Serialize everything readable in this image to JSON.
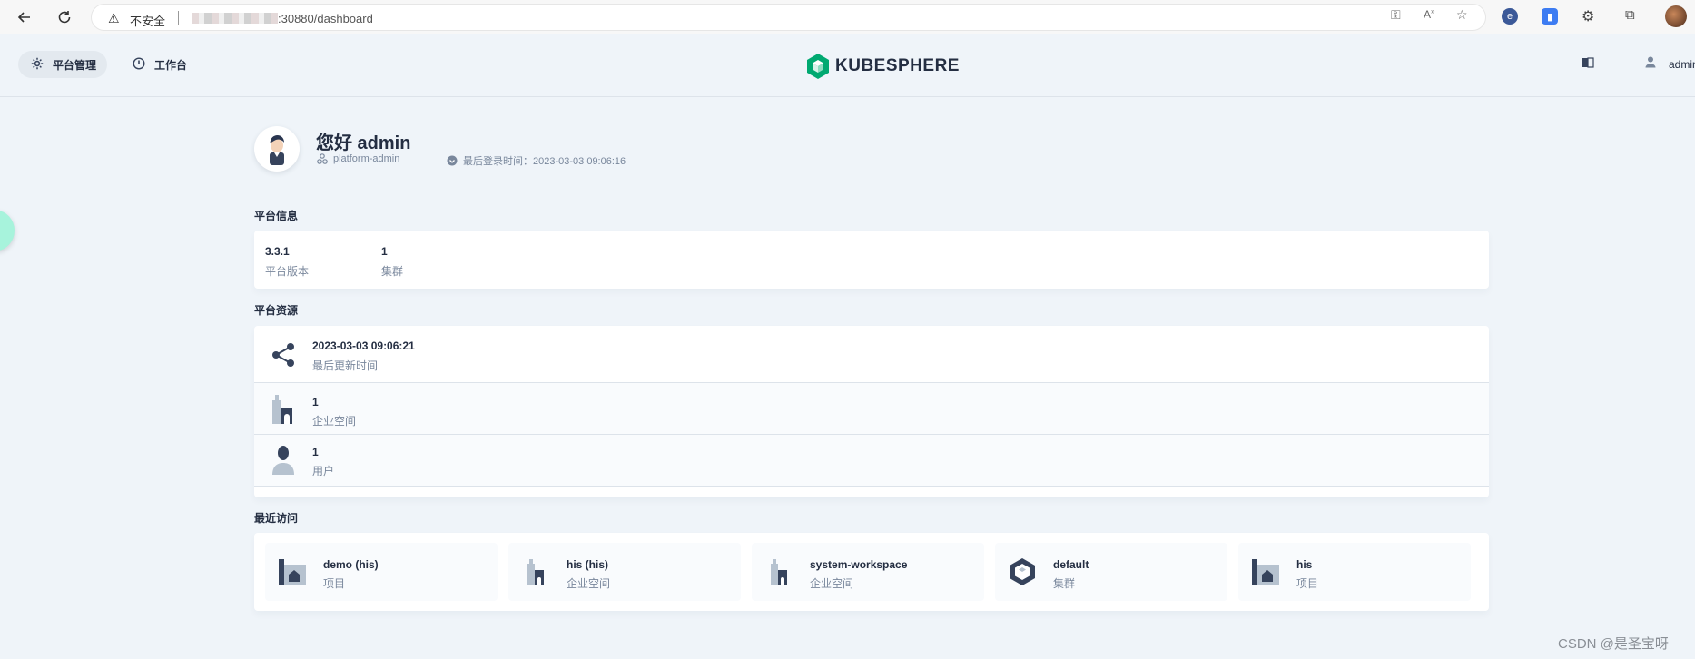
{
  "browser": {
    "security_label": "不安全",
    "url_suffix": ":30880/dashboard"
  },
  "header": {
    "nav": [
      {
        "label": "平台管理",
        "icon": "gear-icon",
        "active": true
      },
      {
        "label": "工作台",
        "icon": "dashboard-icon",
        "active": false
      }
    ],
    "logo_text": "KUBESPHERE",
    "user_label": "admin"
  },
  "welcome": {
    "greeting": "您好 admin",
    "role": "platform-admin",
    "last_login": "最后登录时间：2023-03-03 09:06:16"
  },
  "platform_info": {
    "title": "平台信息",
    "items": [
      {
        "value": "3.3.1",
        "label": "平台版本"
      },
      {
        "value": "1",
        "label": "集群"
      }
    ]
  },
  "platform_resources": {
    "title": "平台资源",
    "items": [
      {
        "value": "2023-03-03 09:06:21",
        "label": "最后更新时间",
        "icon": "share-icon"
      },
      {
        "value": "1",
        "label": "企业空间",
        "icon": "workspace-icon"
      },
      {
        "value": "1",
        "label": "用户",
        "icon": "user-icon"
      }
    ]
  },
  "recent": {
    "title": "最近访问",
    "items": [
      {
        "name": "demo (his)",
        "type": "项目",
        "icon": "project-icon"
      },
      {
        "name": "his (his)",
        "type": "企业空间",
        "icon": "workspace-icon"
      },
      {
        "name": "system-workspace",
        "type": "企业空间",
        "icon": "workspace-icon"
      },
      {
        "name": "default",
        "type": "集群",
        "icon": "cluster-icon"
      },
      {
        "name": "his",
        "type": "项目",
        "icon": "project-icon"
      }
    ]
  },
  "watermark": "CSDN @是圣宝呀",
  "colors": {
    "background": "#eff4f9",
    "text_primary": "#242e42",
    "text_secondary": "#79879c",
    "brand_green": "#00a971"
  }
}
